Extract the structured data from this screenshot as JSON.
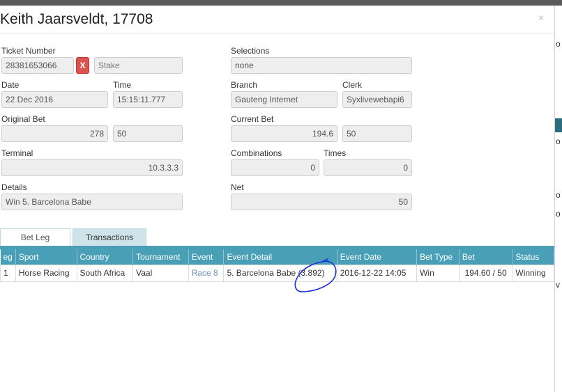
{
  "modal": {
    "title": "Keith Jaarsveldt, 17708",
    "close_glyph": "×"
  },
  "fields": {
    "ticket_number": {
      "label": "Ticket Number",
      "value": "28381653066"
    },
    "cancel_button": "X",
    "stake": {
      "placeholder": "Stake"
    },
    "selections": {
      "label": "Selections",
      "value": "none"
    },
    "date": {
      "label": "Date",
      "value": "22 Dec 2016"
    },
    "time": {
      "label": "Time",
      "value": "15:15:11.777"
    },
    "branch": {
      "label": "Branch",
      "value": "Gauteng Internet"
    },
    "clerk": {
      "label": "Clerk",
      "value": "Syxlivewebapi6"
    },
    "original_bet": {
      "label": "Original Bet",
      "value": "278",
      "secondary": "50"
    },
    "current_bet": {
      "label": "Current Bet",
      "value": "194.6",
      "secondary": "50"
    },
    "terminal": {
      "label": "Terminal",
      "value": "10.3.3.3"
    },
    "combinations": {
      "label": "Combinations",
      "value": "0"
    },
    "times": {
      "label": "Times",
      "value": "0"
    },
    "details": {
      "label": "Details",
      "value": "Win 5. Barcelona Babe"
    },
    "net": {
      "label": "Net",
      "value": "50"
    }
  },
  "tabs": [
    {
      "label": "Bet Leg",
      "active": true
    },
    {
      "label": "Transactions",
      "active": false
    }
  ],
  "table": {
    "headers": [
      "eg",
      "Sport",
      "Country",
      "Tournament",
      "Event",
      "Event Detail",
      "Event Date",
      "Bet Type",
      "Bet",
      "Status"
    ],
    "rows": [
      [
        "1",
        "Horse Racing",
        "South Africa",
        "Vaal",
        "Race 8",
        "5. Barcelona Babe (3.892)",
        "2016-12-22 14:05",
        "Win",
        "194.60 / 50",
        "Winning"
      ]
    ]
  },
  "right_edge_glyphs": [
    "o",
    "o",
    "o",
    "o",
    "v"
  ],
  "colors": {
    "table_header": "#49a0b6",
    "danger": "#d9534f",
    "annotation": "#1a2fd6"
  }
}
